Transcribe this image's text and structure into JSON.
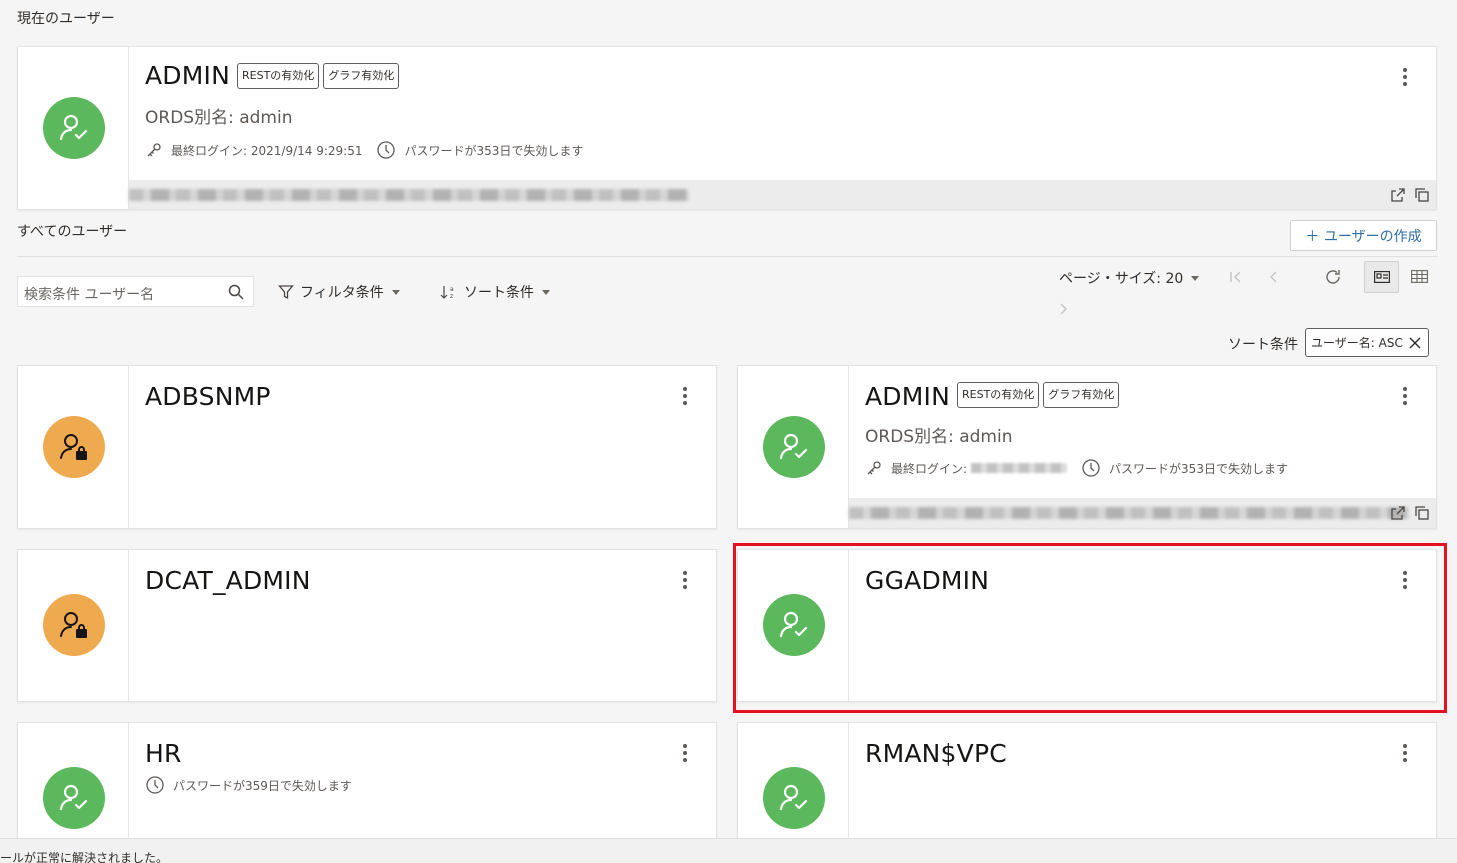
{
  "current_section": {
    "title": "現在のユーザー"
  },
  "current_user": {
    "name": "ADMIN",
    "badges": [
      "RESTの有効化",
      "グラフ有効化"
    ],
    "alias": "ORDS別名: admin",
    "last_login": "最終ログイン: 2021/9/14 9:29:51",
    "password_expiry": "パスワードが353日で失効します"
  },
  "all_section": {
    "title": "すべてのユーザー"
  },
  "toolbar": {
    "create_button": "＋ ユーザーの作成",
    "search_placeholder": "検索条件 ユーザー名",
    "filter_label": "フィルタ条件",
    "sort_label": "ソート条件",
    "page_size_label": "ページ・サイズ: 20",
    "sort_applied_label": "ソート条件",
    "sort_chip": "ユーザー名: ASC"
  },
  "users": [
    {
      "name": "ADBSNMP",
      "status": "locked"
    },
    {
      "name": "ADMIN",
      "status": "active",
      "badges": [
        "RESTの有効化",
        "グラフ有効化"
      ],
      "alias": "ORDS別名: admin",
      "last_login": "最終ログイン:",
      "password_expiry": "パスワードが353日で失効します"
    },
    {
      "name": "DCAT_ADMIN",
      "status": "locked"
    },
    {
      "name": "GGADMIN",
      "status": "active"
    },
    {
      "name": "HR",
      "status": "active",
      "password_expiry": "パスワードが359日で失効します"
    },
    {
      "name": "RMAN$VPC",
      "status": "active"
    }
  ],
  "status_bar": {
    "message": "ールが正常に解決されました。"
  },
  "colors": {
    "active_avatar": "#5cb85c",
    "locked_avatar": "#efaa50",
    "highlight": "#e3121e",
    "link": "#2f6da3"
  }
}
